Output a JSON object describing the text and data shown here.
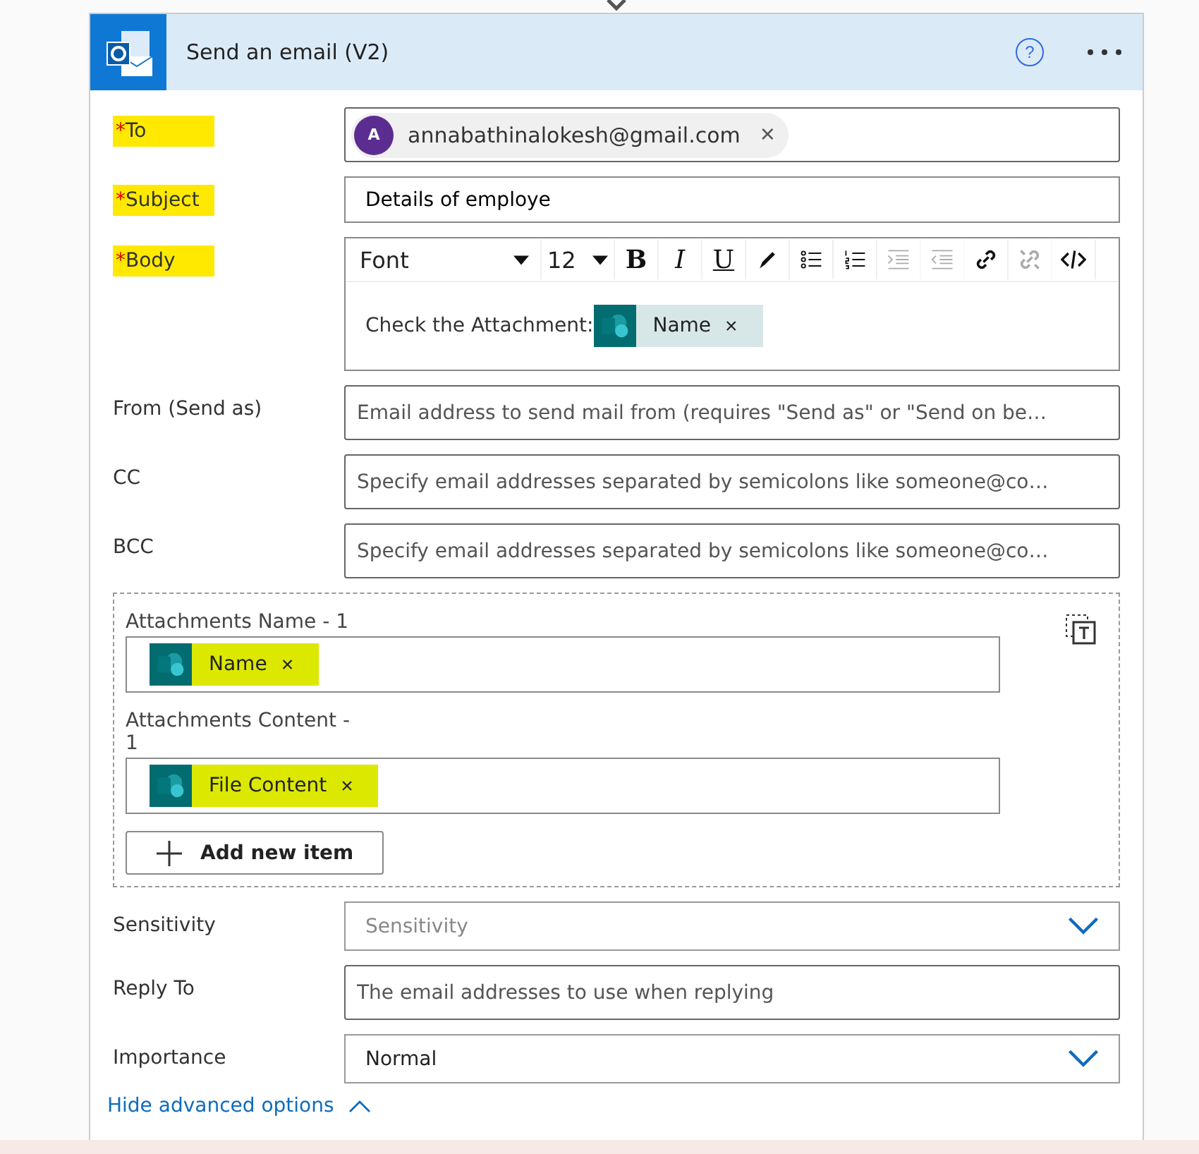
{
  "card": {
    "title": "Send an email (V2)",
    "help": "?"
  },
  "fields": [
    {
      "kind": "recipients",
      "label": "To",
      "required_mark": "*",
      "highlighted": true,
      "chips": [
        {
          "avatar": "A",
          "text": "annabathinalokesh@gmail.com",
          "remove": "×"
        }
      ]
    },
    {
      "kind": "text",
      "label": "Subject",
      "required_mark": "*",
      "highlighted": true,
      "value": "Details of employe"
    },
    {
      "kind": "rich",
      "label": "Body",
      "required_mark": "*",
      "highlighted": true,
      "font": "Font",
      "size": "12",
      "toolbar": [
        {
          "kind": "bold",
          "text": "B",
          "disabled": false
        },
        {
          "kind": "italic",
          "text": "I",
          "disabled": false
        },
        {
          "kind": "underline",
          "text": "U",
          "disabled": false
        },
        {
          "kind": "pen",
          "disabled": false
        },
        {
          "kind": "bullets",
          "disabled": false
        },
        {
          "kind": "numbers",
          "disabled": false
        },
        {
          "kind": "indent",
          "disabled": true
        },
        {
          "kind": "outdent",
          "disabled": true
        },
        {
          "kind": "link",
          "disabled": false
        },
        {
          "kind": "unlink",
          "disabled": true
        },
        {
          "kind": "code",
          "disabled": false
        }
      ],
      "text": "Check the Attachment:",
      "tokens": [
        {
          "text": "Name",
          "remove": "×",
          "highlighted": false
        }
      ]
    },
    {
      "kind": "placeholder",
      "label": "From (Send as)",
      "highlighted": false,
      "placeholder": "Email address to send mail from (requires \"Send as\" or \"Send on be…"
    },
    {
      "kind": "placeholder",
      "label": "CC",
      "highlighted": false,
      "placeholder": "Specify email addresses separated by semicolons like someone@co…"
    },
    {
      "kind": "placeholder",
      "label": "BCC",
      "highlighted": false,
      "placeholder": "Specify email addresses separated by semicolons like someone@co…"
    },
    {
      "kind": "attachments",
      "items": [
        {
          "label": "Attachments Name - 1",
          "tokens": [
            {
              "text": "Name",
              "remove": "×",
              "highlighted": true
            }
          ]
        },
        {
          "label": "Attachments Content - 1",
          "tokens": [
            {
              "text": "File Content",
              "remove": "×",
              "highlighted": true
            }
          ]
        }
      ],
      "add": "Add new item"
    },
    {
      "kind": "dropdown",
      "label": "Sensitivity",
      "highlighted": false,
      "placeholder": "Sensitivity"
    },
    {
      "kind": "placeholder",
      "label": "Reply To",
      "highlighted": false,
      "placeholder": "The email addresses to use when replying"
    },
    {
      "kind": "dropdown",
      "label": "Importance",
      "highlighted": false,
      "value": "Normal"
    }
  ],
  "advanced_link": "Hide advanced options"
}
